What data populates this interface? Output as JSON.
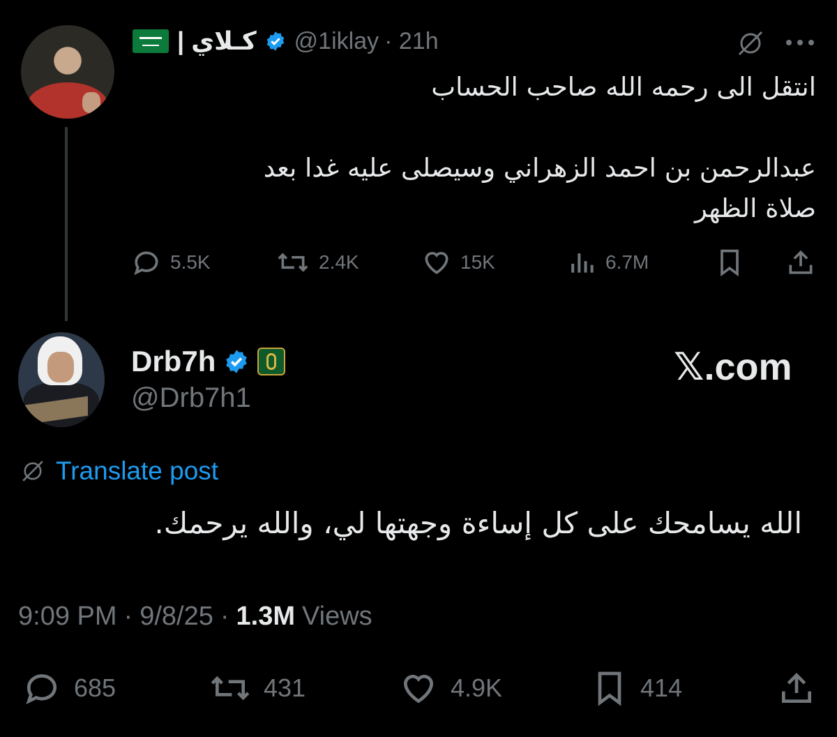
{
  "tweet1": {
    "display_name": "كـلاي |",
    "flag_emoji": "🇸🇦",
    "handle": "@1iklay",
    "time": "· 21h",
    "text_lines": [
      "انتقل الى رحمه الله صاحب الحساب",
      "",
      "عبدالرحمن بن احمد الزهراني وسيصلى عليه غدا بعد",
      "صلاة الظهر"
    ],
    "stats": {
      "replies": "5.5K",
      "reposts": "2.4K",
      "likes": "15K",
      "views": "6.7M"
    }
  },
  "tweet2": {
    "display_name": "Drb7h",
    "handle": "@Drb7h1",
    "watermark": "𝕏.com",
    "translate_label": "Translate post",
    "text": "الله يسامحك على كل إساءة وجهتها لي، والله يرحمك.",
    "meta": {
      "time": "9:09 PM",
      "date": "9/8/25",
      "views_count": "1.3M",
      "views_label": "Views"
    },
    "stats": {
      "replies": "685",
      "reposts": "431",
      "likes": "4.9K",
      "bookmarks": "414"
    }
  },
  "colors": {
    "background": "#000000",
    "text": "#e7e9ea",
    "muted": "#71767b",
    "link": "#1d9bf0",
    "verified": "#1d9bf0"
  }
}
